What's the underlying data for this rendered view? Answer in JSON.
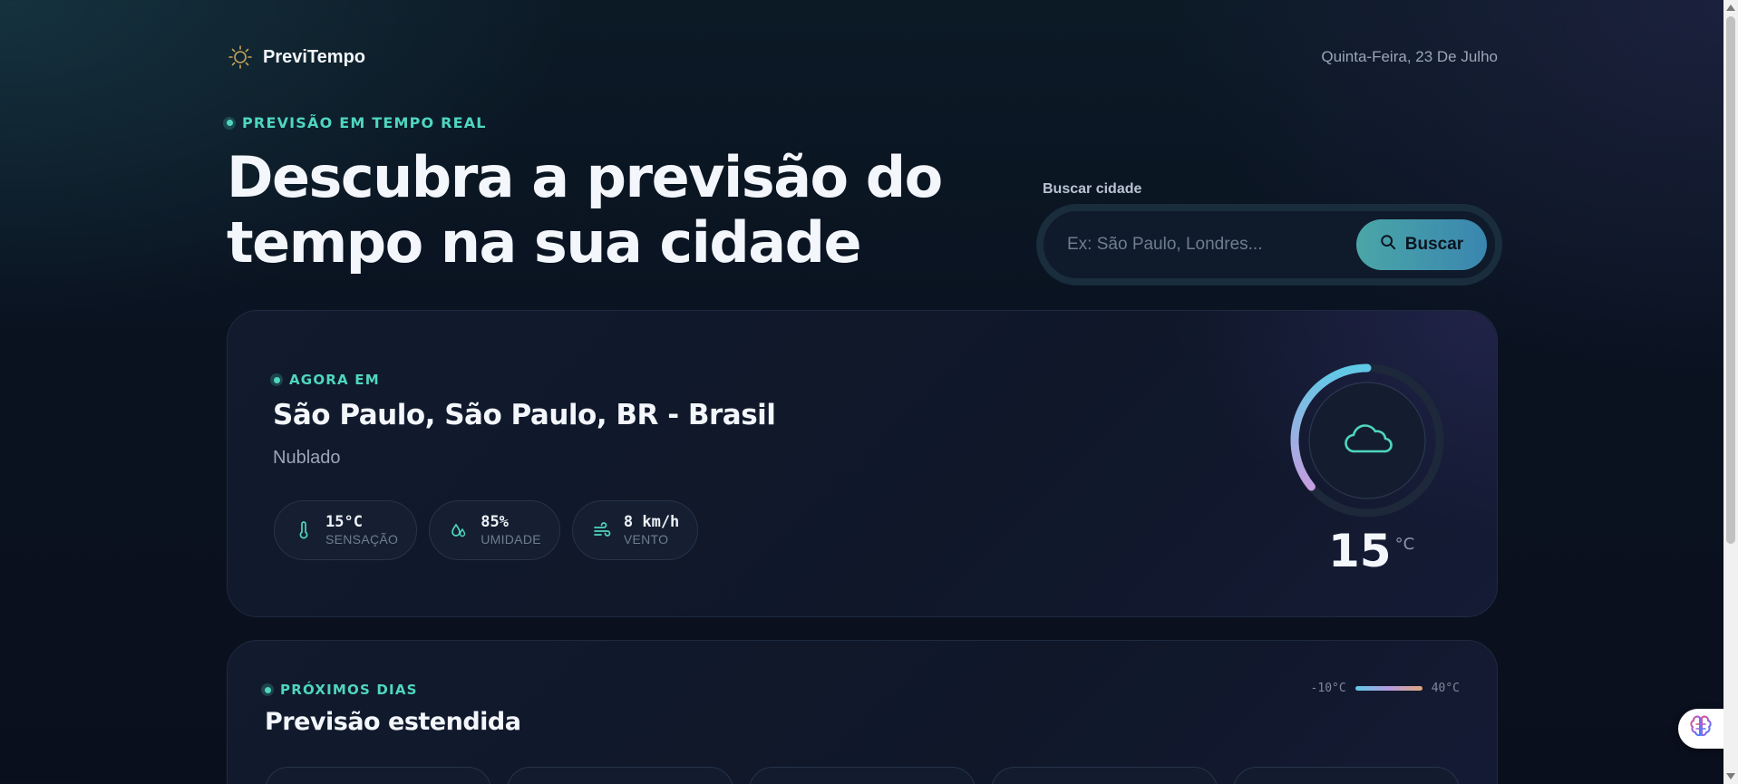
{
  "header": {
    "brand": "PreviTempo",
    "date": "Quinta-Feira, 23 De Julho"
  },
  "hero": {
    "eyebrow": "PREVISÃO EM TEMPO REAL",
    "title_line1": "Descubra a previsão do",
    "title_line2": "tempo na sua cidade"
  },
  "search": {
    "label": "Buscar cidade",
    "placeholder": "Ex: São Paulo, Londres...",
    "button": "Buscar"
  },
  "current": {
    "eyebrow": "AGORA EM",
    "city": "São Paulo, São Paulo, BR - Brasil",
    "description": "Nublado",
    "stats": [
      {
        "icon": "thermometer-icon",
        "value": "15°C",
        "label": "SENSAÇÃO"
      },
      {
        "icon": "droplets-icon",
        "value": "85%",
        "label": "UMIDADE"
      },
      {
        "icon": "wind-icon",
        "value": "8 km/h",
        "label": "VENTO"
      }
    ],
    "temperature": "15",
    "unit": "°C",
    "gauge_icon": "cloud-icon",
    "gauge_fraction": 0.36
  },
  "forecast": {
    "eyebrow": "PRÓXIMOS DIAS",
    "title": "Previsão estendida",
    "range_min": "-10°C",
    "range_max": "40°C"
  },
  "colors": {
    "accent": "#4fd6c0",
    "button_start": "#4aa6a7",
    "button_end": "#3a86b0"
  }
}
